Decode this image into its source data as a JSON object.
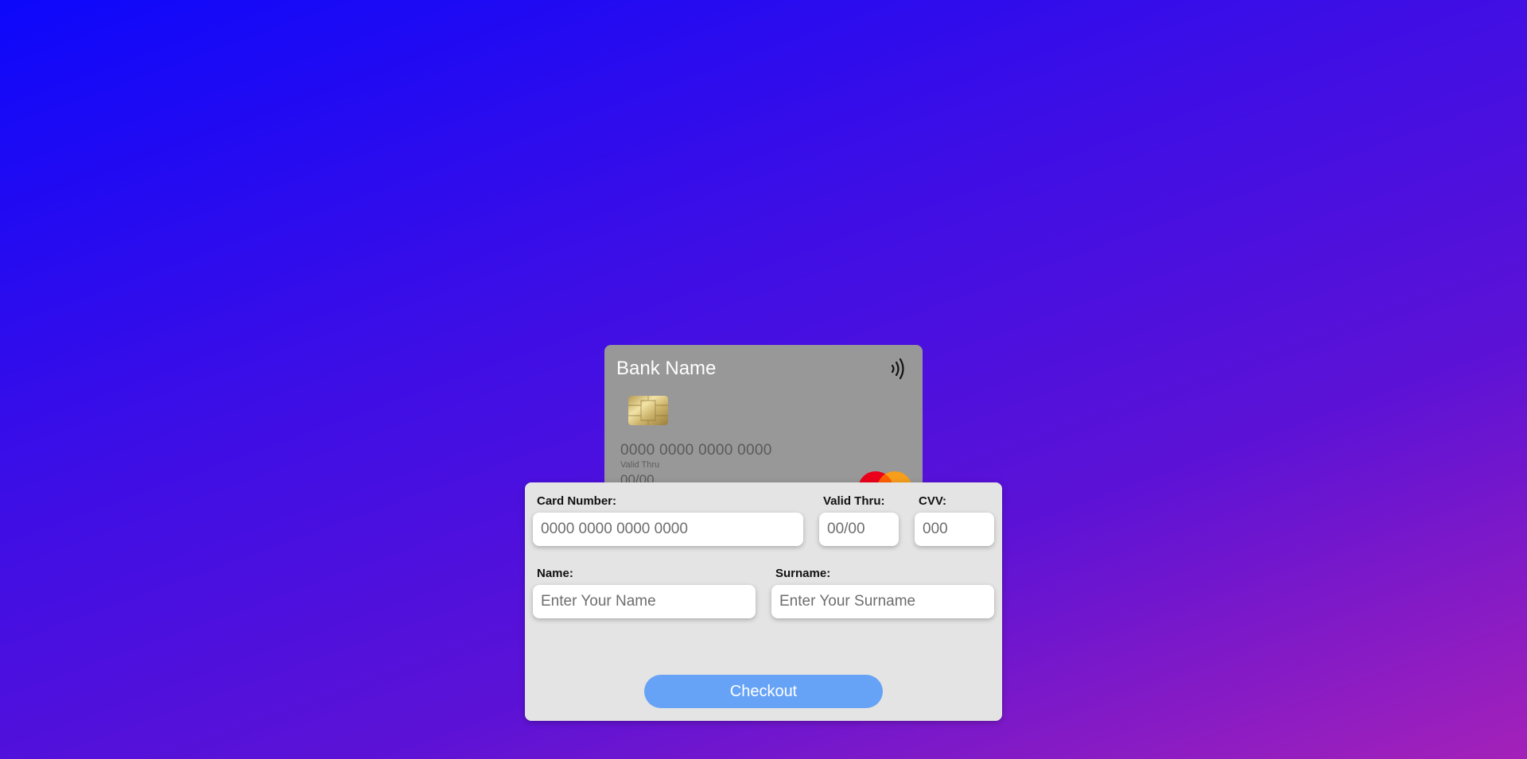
{
  "card_preview": {
    "bank_name": "Bank Name",
    "contactless_icon": "contactless-icon",
    "chip_icon": "chip-icon",
    "card_number": "0000 0000 0000 0000",
    "valid_thru_label": "Valid Thru",
    "valid_thru_value": "00/00",
    "network_logo": "mastercard-logo",
    "background_color": "#989898"
  },
  "form": {
    "card_number": {
      "label": "Card Number:",
      "placeholder": "0000 0000 0000 0000",
      "value": ""
    },
    "valid_thru": {
      "label": "Valid Thru:",
      "placeholder": "00/00",
      "value": ""
    },
    "cvv": {
      "label": "CVV:",
      "placeholder": "000",
      "value": ""
    },
    "name": {
      "label": "Name:",
      "placeholder": "Enter Your Name",
      "value": ""
    },
    "surname": {
      "label": "Surname:",
      "placeholder": "Enter Your Surname",
      "value": ""
    },
    "checkout_label": "Checkout"
  },
  "colors": {
    "page_gradient": [
      "#0d08fb",
      "#3d0ee6",
      "#5c12d6",
      "#a421b9"
    ],
    "panel_background": "#e4e4e4",
    "button_background": "#66a3f6",
    "button_text": "#ffffff"
  }
}
